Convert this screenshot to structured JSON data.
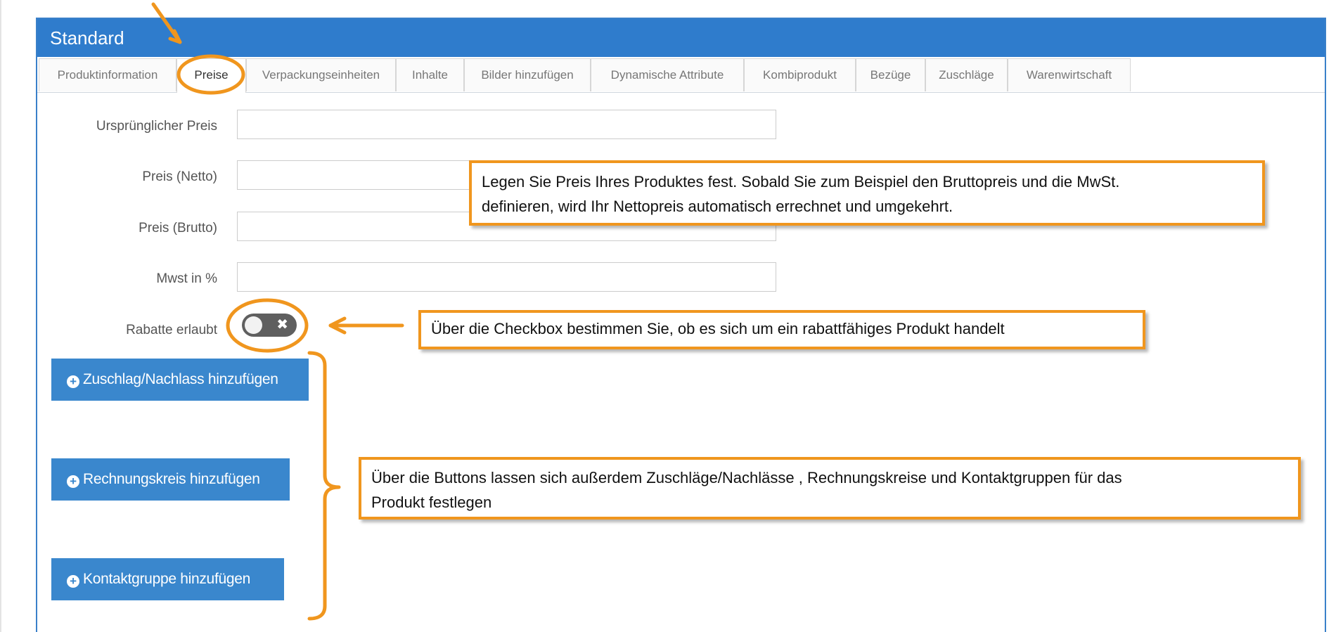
{
  "panel": {
    "title": "Standard"
  },
  "tabs": [
    {
      "label": "Produktinformation",
      "active": false
    },
    {
      "label": "Preise",
      "active": true
    },
    {
      "label": "Verpackungseinheiten",
      "active": false
    },
    {
      "label": "Inhalte",
      "active": false
    },
    {
      "label": "Bilder hinzufügen",
      "active": false
    },
    {
      "label": "Dynamische Attribute",
      "active": false
    },
    {
      "label": "Kombiprodukt",
      "active": false
    },
    {
      "label": "Bezüge",
      "active": false
    },
    {
      "label": "Zuschläge",
      "active": false
    },
    {
      "label": "Warenwirtschaft",
      "active": false
    }
  ],
  "form": {
    "fields": [
      {
        "label": "Ursprünglicher Preis",
        "value": ""
      },
      {
        "label": "Preis (Netto)",
        "value": ""
      },
      {
        "label": "Preis (Brutto)",
        "value": ""
      },
      {
        "label": "Mwst in %",
        "value": ""
      }
    ],
    "rabatte": {
      "label": "Rabatte erlaubt",
      "checked": false,
      "off_glyph": "✖"
    }
  },
  "buttons": {
    "icon_glyph": "+",
    "zuschlag": "Zuschlag/Nachlass hinzufügen",
    "rechnungskreis": "Rechnungskreis hinzufügen",
    "kontaktgruppe": "Kontaktgruppe hinzufügen"
  },
  "annotations": {
    "price_note_line1": "Legen Sie Preis Ihres Produktes fest. Sobald Sie zum Beispiel den Bruttopreis und die MwSt.",
    "price_note_line2": "definieren, wird Ihr Nettopreis automatisch errechnet und umgekehrt.",
    "checkbox_note": "Über die Checkbox bestimmen Sie, ob es sich um ein rabattfähiges Produkt handelt",
    "buttons_note_line1": "Über die Buttons lassen sich außerdem Zuschläge/Nachlässe , Rechnungskreise und Kontaktgruppen  für das",
    "buttons_note_line2": "Produkt festlegen"
  },
  "colors": {
    "header_blue": "#2f7ccc",
    "button_blue": "#3a87cd",
    "annotation_orange": "#f0961e",
    "toggle_off": "#5f5f5f"
  }
}
